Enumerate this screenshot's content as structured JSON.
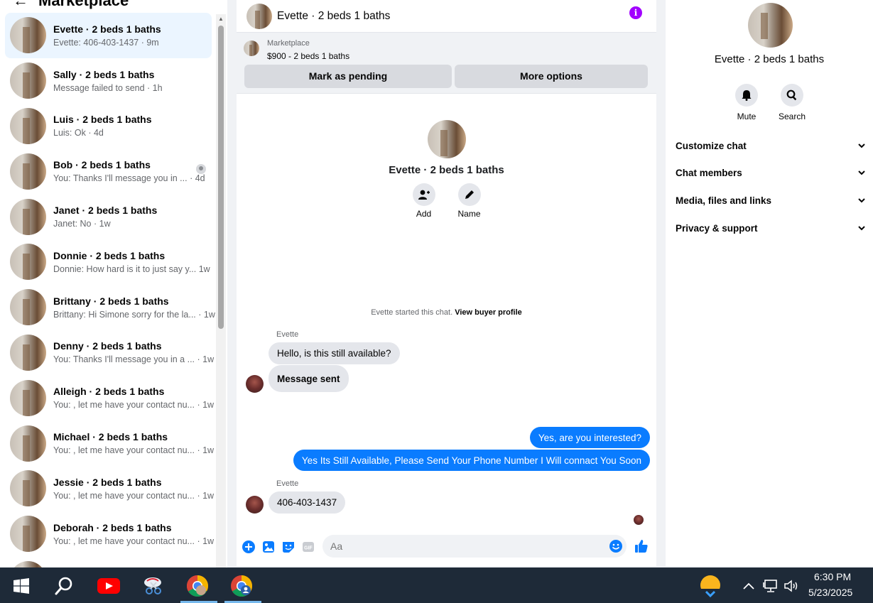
{
  "sidebar": {
    "title": "Marketplace",
    "conversations": [
      {
        "name": "Evette · 2 beds 1 baths",
        "preview": "Evette: 406-403-1437",
        "time": "9m"
      },
      {
        "name": "Sally · 2 beds 1 baths",
        "preview": "Message failed to send",
        "time": "1h"
      },
      {
        "name": "Luis · 2 beds 1 baths",
        "preview": "Luis: Ok",
        "time": "4d"
      },
      {
        "name": "Bob · 2 beds 1 baths",
        "preview": "You: Thanks I'll message you in ...",
        "time": "4d"
      },
      {
        "name": "Janet · 2 beds 1 baths",
        "preview": "Janet: No",
        "time": "1w"
      },
      {
        "name": "Donnie · 2 beds 1 baths",
        "preview": "Donnie: How hard is it to just say y...",
        "time": "1w"
      },
      {
        "name": "Brittany · 2 beds 1 baths",
        "preview": "Brittany: Hi Simone sorry for the la...",
        "time": "1w"
      },
      {
        "name": "Denny · 2 beds 1 baths",
        "preview": "You: Thanks I'll message you in a ...",
        "time": "1w"
      },
      {
        "name": "Alleigh · 2 beds 1 baths",
        "preview": "You: , let me have your contact nu...",
        "time": "1w"
      },
      {
        "name": "Michael · 2 beds 1 baths",
        "preview": "You: , let me have your contact nu...",
        "time": "1w"
      },
      {
        "name": "Jessie · 2 beds 1 baths",
        "preview": "You: , let me have your contact nu...",
        "time": "1w"
      },
      {
        "name": "Deborah · 2 beds 1 baths",
        "preview": "You: , let me have your contact nu...",
        "time": "1w"
      }
    ]
  },
  "chat": {
    "header_name": "Evette · 2 beds 1 baths",
    "listing_label": "Marketplace",
    "listing_price": "$900 - 2 beds 1 baths",
    "mark_pending": "Mark as pending",
    "more_options": "More options",
    "profile_name": "Evette · 2 beds 1 baths",
    "add_label": "Add",
    "name_label": "Name",
    "started_text": "Evette started this chat.",
    "view_buyer": "View buyer profile",
    "sender_1": "Evette",
    "msg_1": "Hello, is this still available?",
    "msg_2": "Message sent",
    "msg_3": "Yes, are you interested?",
    "msg_4": "Yes Its Still Available, Please Send Your Phone Number I Will connact You Soon",
    "sender_2": "Evette",
    "msg_5": "406-403-1437",
    "composer_placeholder": "Aa"
  },
  "details": {
    "name": "Evette · 2 beds 1 baths",
    "mute_label": "Mute",
    "search_label": "Search",
    "sections": [
      "Customize chat",
      "Chat members",
      "Media, files and links",
      "Privacy & support"
    ]
  },
  "taskbar": {
    "time": "6:30 PM",
    "date": "5/23/2025"
  },
  "colors": {
    "accent": "#0a7cff",
    "info": "#a200ff",
    "taskbar": "#1e2a38"
  }
}
